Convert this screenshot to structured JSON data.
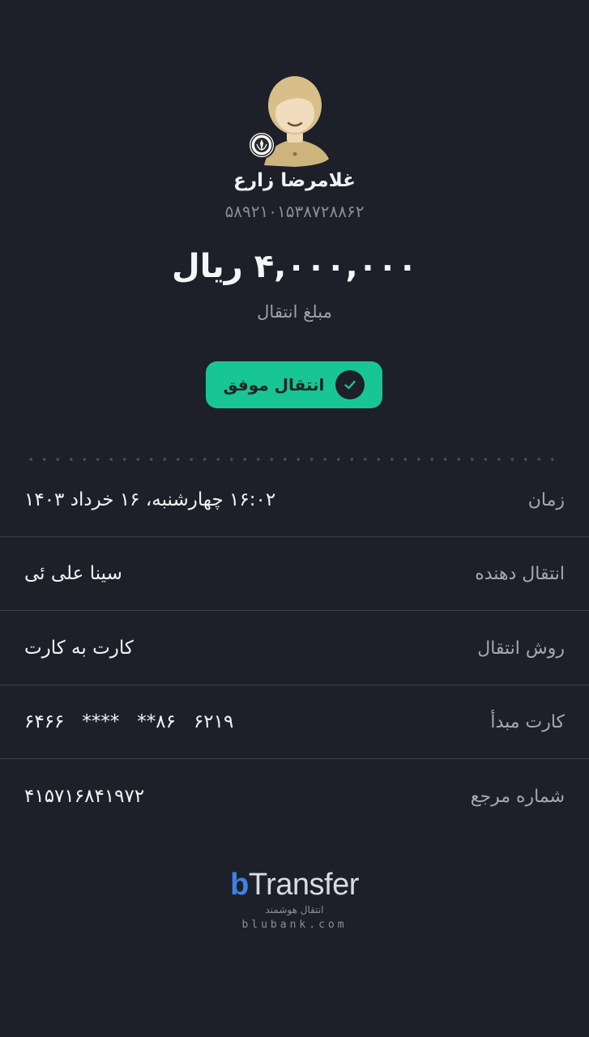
{
  "recipient": {
    "name": "غلامرضا زارع",
    "card_number": "۵۸۹۲۱۰۱۵۳۸۷۲۸۸۶۲"
  },
  "transfer": {
    "amount": "۴,۰۰۰,۰۰۰ ریال",
    "amount_label": "مبلغ انتقال",
    "status": "انتقال موفق"
  },
  "details": [
    {
      "label": "زمان",
      "value": "۱۶:۰۲ چهارشنبه، ۱۶ خرداد ۱۴۰۳"
    },
    {
      "label": "انتقال دهنده",
      "value": "سینا علی ئی"
    },
    {
      "label": "روش انتقال",
      "value": "کارت به کارت"
    },
    {
      "label": "کارت مبدأ",
      "value": "۶۲۱۹   ۸۶**   ****   ۶۴۶۶"
    },
    {
      "label": "شماره مرجع",
      "value": "۴۱۵۷۱۶۸۴۱۹۷۲"
    }
  ],
  "brand": {
    "logo_b": "b",
    "logo_rest": "Transfer",
    "tagline": "انتقال هوشمند",
    "domain": "blubank.com"
  },
  "colors": {
    "background": "#1d2028",
    "success": "#18c594",
    "brand_blue": "#3f82e6"
  },
  "icons": {
    "avatar": "user-avatar-icon",
    "bank": "bank-seal-icon",
    "status": "check-circle-icon"
  }
}
